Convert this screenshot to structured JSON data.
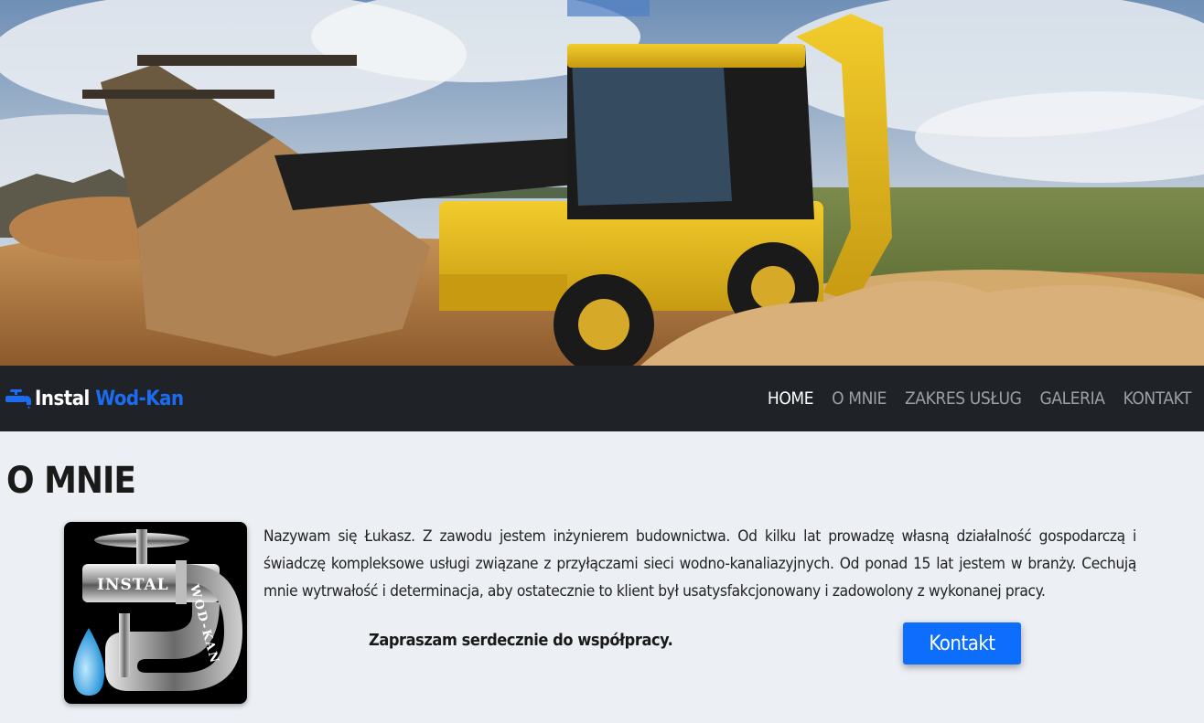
{
  "navbar": {
    "brand_first": "Instal",
    "brand_second": "Wod-Kan",
    "brand_icon": "faucet-icon",
    "links": [
      {
        "label": "HOME",
        "active": true
      },
      {
        "label": "O MNIE",
        "active": false
      },
      {
        "label": "ZAKRES USŁUG",
        "active": false
      },
      {
        "label": "GALERIA",
        "active": false
      },
      {
        "label": "KONTAKT",
        "active": false
      }
    ]
  },
  "about": {
    "title": "O MNIE",
    "logo_text_left": "INSTAL",
    "logo_text_right": "WOD-KAN",
    "paragraph": "Nazywam się Łukasz. Z zawodu jestem inżynierem budownictwa. Od kilku lat prowadzę własną działalność gospodarczą i świadczę kompleksowe usługi związane z przyłączami sieci wodno-kanaliazyjnych. Od ponad 15 lat jestem w branży. Cechują mnie wytrwałość i determinacja, aby ostatecznie to klient był usatysfakcjonowany i zadowolony z wykonanej pracy.",
    "invite": "Zapraszam serdecznie do współpracy.",
    "button_label": "Kontakt"
  },
  "colors": {
    "navbar_bg": "#1f2328",
    "accent": "#1c6cf2",
    "button": "#0d6efd",
    "page_bg": "#eceff4"
  }
}
